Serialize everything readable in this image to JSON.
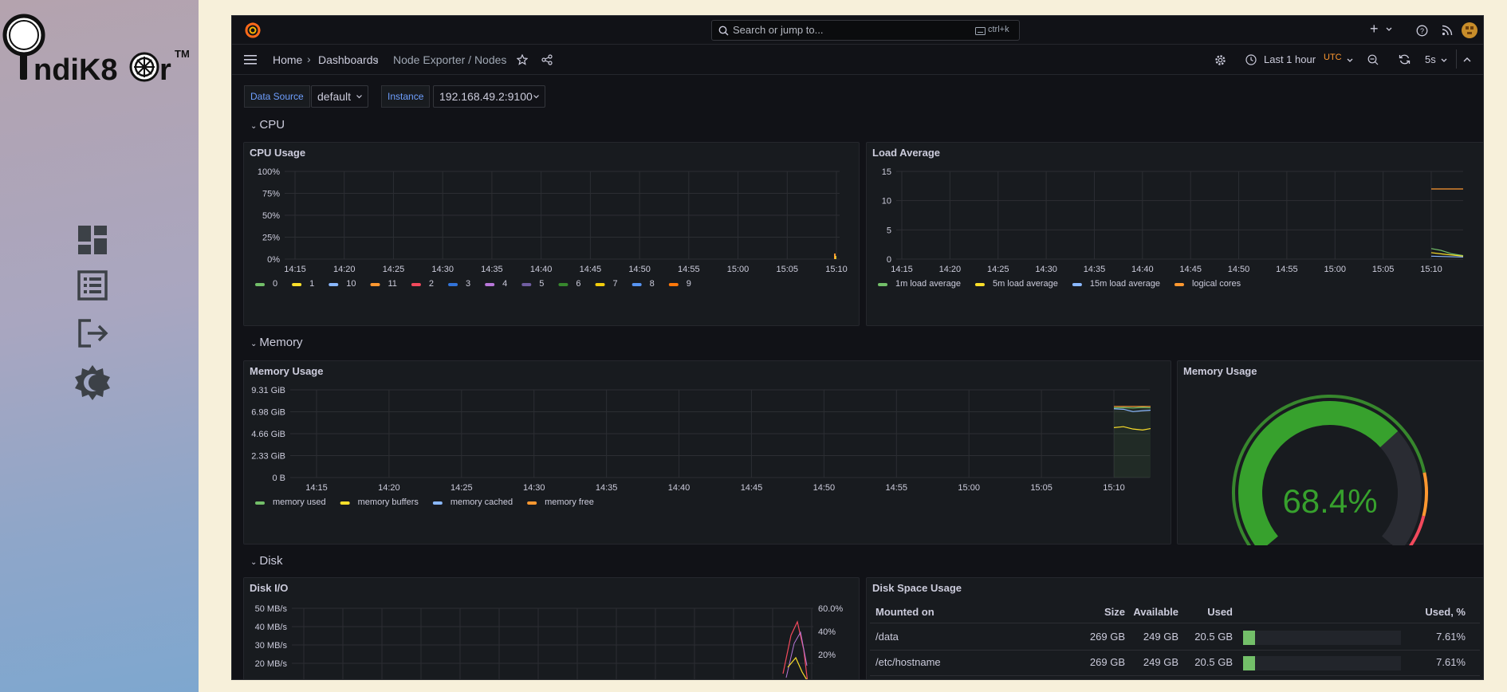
{
  "app": {
    "logo_text": "ndiK8",
    "logo_tail": "r",
    "trademark": "TM",
    "nav_icons": [
      "dashboard-icon",
      "list-icon",
      "logout-icon",
      "theme-toggle-icon"
    ]
  },
  "topbar": {
    "search_placeholder": "Search or jump to...",
    "search_shortcut": "ctrl+k"
  },
  "navbar": {
    "breadcrumb": [
      "Home",
      "Dashboards",
      "Node Exporter / Nodes"
    ],
    "sep": "›",
    "time_range": "Last 1 hour",
    "timezone": "UTC",
    "refresh": "5s"
  },
  "variables": {
    "datasource_label": "Data Source",
    "datasource_value": "default",
    "instance_label": "Instance",
    "instance_value": "192.168.49.2:9100"
  },
  "rows": {
    "cpu": "CPU",
    "memory": "Memory",
    "disk": "Disk"
  },
  "panels": {
    "cpu_usage": "CPU Usage",
    "load_average": "Load Average",
    "memory_usage": "Memory Usage",
    "memory_gauge": "Memory Usage",
    "disk_io": "Disk I/O",
    "disk_space": "Disk Space Usage"
  },
  "chart_data": [
    {
      "type": "line",
      "title": "CPU Usage",
      "x": [
        "14:15",
        "14:20",
        "14:25",
        "14:30",
        "14:35",
        "14:40",
        "14:45",
        "14:50",
        "14:55",
        "15:00",
        "15:05",
        "15:10"
      ],
      "y_ticks": [
        "100%",
        "75%",
        "50%",
        "25%",
        "0%"
      ],
      "ylim": [
        0,
        100
      ],
      "series": [
        {
          "name": "0",
          "color": "#73bf69"
        },
        {
          "name": "1",
          "color": "#fade2a"
        },
        {
          "name": "10",
          "color": "#5794f2"
        },
        {
          "name": "11",
          "color": "#ff9830"
        },
        {
          "name": "2",
          "color": "#f2495c"
        },
        {
          "name": "3",
          "color": "#3274d9"
        },
        {
          "name": "4",
          "color": "#b877d9"
        },
        {
          "name": "5",
          "color": "#705da0"
        },
        {
          "name": "6",
          "color": "#37872d"
        },
        {
          "name": "7",
          "color": "#fade2a"
        },
        {
          "name": "8",
          "color": "#5794f2"
        },
        {
          "name": "9",
          "color": "#ff780a"
        }
      ],
      "legend_colors": [
        "#73bf69",
        "#fade2a",
        "#8ab8ff",
        "#ff9830",
        "#f2495c",
        "#3274d9",
        "#b877d9",
        "#705da0",
        "#37872d",
        "#f2cc0c",
        "#5794f2",
        "#ff780a"
      ],
      "grid": true,
      "legend": "bottom-left"
    },
    {
      "type": "line",
      "title": "Load Average",
      "x": [
        "14:15",
        "14:20",
        "14:25",
        "14:30",
        "14:35",
        "14:40",
        "14:45",
        "14:50",
        "14:55",
        "15:00",
        "15:05",
        "15:10"
      ],
      "y_ticks": [
        "15",
        "10",
        "5",
        "0"
      ],
      "ylim": [
        0,
        15
      ],
      "series": [
        {
          "name": "1m load average",
          "color": "#73bf69",
          "values": [
            1.8,
            1.5,
            0.9,
            0.6
          ]
        },
        {
          "name": "5m load average",
          "color": "#fade2a",
          "values": [
            1.1,
            0.9,
            0.7,
            0.5
          ]
        },
        {
          "name": "15m load average",
          "color": "#8ab8ff",
          "values": [
            0.5,
            0.45,
            0.4,
            0.35
          ]
        },
        {
          "name": "logical cores",
          "color": "#ff9830",
          "values": [
            12,
            12,
            12,
            12
          ]
        }
      ],
      "grid": true,
      "legend": "bottom-left"
    },
    {
      "type": "area",
      "title": "Memory Usage",
      "x": [
        "14:15",
        "14:20",
        "14:25",
        "14:30",
        "14:35",
        "14:40",
        "14:45",
        "14:50",
        "14:55",
        "15:00",
        "15:05",
        "15:10"
      ],
      "y_ticks": [
        "9.31 GiB",
        "6.98 GiB",
        "4.66 GiB",
        "2.33 GiB",
        "0 B"
      ],
      "ylim": [
        0,
        9.31
      ],
      "series": [
        {
          "name": "memory used",
          "color": "#73bf69"
        },
        {
          "name": "memory buffers",
          "color": "#fade2a"
        },
        {
          "name": "memory cached",
          "color": "#8ab8ff"
        },
        {
          "name": "memory free",
          "color": "#ff9830"
        }
      ],
      "grid": true,
      "legend": "bottom-left"
    },
    {
      "type": "gauge",
      "title": "Memory Usage",
      "value": 68.4,
      "display": "68.4%",
      "thresholds": [
        {
          "to": 80,
          "color": "#37872d"
        },
        {
          "to": 90,
          "color": "#ff9830"
        },
        {
          "to": 100,
          "color": "#f2495c"
        }
      ]
    },
    {
      "type": "line",
      "title": "Disk I/O",
      "y_ticks": [
        "50 MB/s",
        "40 MB/s",
        "30 MB/s",
        "20 MB/s"
      ],
      "y2_ticks": [
        "60.0%",
        "40%",
        "20%"
      ],
      "grid": true
    },
    {
      "type": "table",
      "title": "Disk Space Usage",
      "columns": [
        "Mounted on",
        "Size",
        "Available",
        "Used",
        "Used, %"
      ],
      "rows": [
        {
          "mount": "/data",
          "size": "269 GB",
          "available": "249 GB",
          "used": "20.5 GB",
          "pct": "7.61%",
          "fraction": 0.0761
        },
        {
          "mount": "/etc/hostname",
          "size": "269 GB",
          "available": "249 GB",
          "used": "20.5 GB",
          "pct": "7.61%",
          "fraction": 0.0761
        }
      ]
    }
  ]
}
